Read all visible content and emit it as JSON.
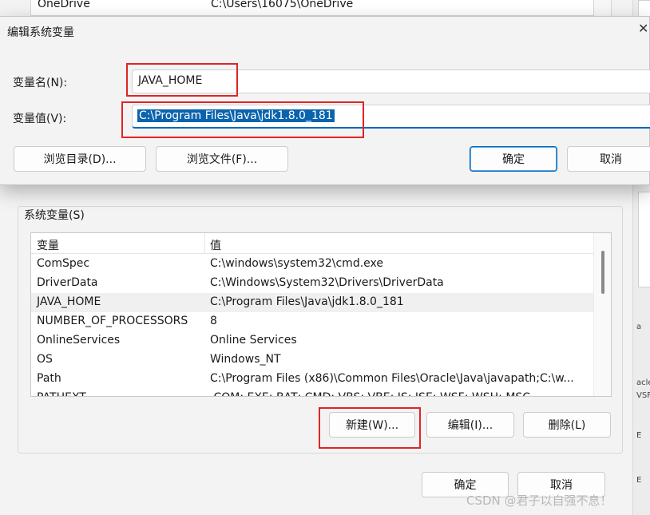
{
  "background_window": {
    "top_row": {
      "name": "OneDrive",
      "value": "C:\\Users\\16075\\OneDrive"
    },
    "system_vars_label": "系统变量(S)",
    "columns": {
      "name": "变量",
      "value": "值"
    },
    "rows": [
      {
        "name": "ComSpec",
        "value": "C:\\windows\\system32\\cmd.exe"
      },
      {
        "name": "DriverData",
        "value": "C:\\Windows\\System32\\Drivers\\DriverData"
      },
      {
        "name": "JAVA_HOME",
        "value": "C:\\Program Files\\Java\\jdk1.8.0_181"
      },
      {
        "name": "NUMBER_OF_PROCESSORS",
        "value": "8"
      },
      {
        "name": "OnlineServices",
        "value": "Online Services"
      },
      {
        "name": "OS",
        "value": "Windows_NT"
      },
      {
        "name": "Path",
        "value": "C:\\Program Files (x86)\\Common Files\\Oracle\\Java\\javapath;C:\\w..."
      },
      {
        "name": "PATHEXT",
        "value": ".COM;.EXE;.BAT;.CMD;.VBS;.VBE;.JS;.JSE;.WSF;.WSH;.MSC"
      }
    ],
    "selected_row_index": 2,
    "buttons": {
      "new": "新建(W)...",
      "edit": "编辑(I)...",
      "delete": "删除(L)"
    },
    "footer": {
      "ok": "确定",
      "cancel": "取消"
    },
    "right_strip_texts": [
      "a",
      "acle\\",
      "VSF;",
      "E",
      "E"
    ]
  },
  "dialog": {
    "title": "编辑系统变量",
    "close_glyph": "✕",
    "name_label": "变量名(N):",
    "name_value": "JAVA_HOME",
    "value_label": "变量值(V):",
    "value_value": "C:\\Program Files\\Java\\jdk1.8.0_181",
    "browse_dir": "浏览目录(D)...",
    "browse_file": "浏览文件(F)...",
    "ok": "确定",
    "cancel": "取消"
  },
  "watermark": "CSDN @君子以自强不息！",
  "colors": {
    "accent": "#0067c0",
    "selection": "#0a64ad",
    "highlight_box": "#e02424"
  }
}
